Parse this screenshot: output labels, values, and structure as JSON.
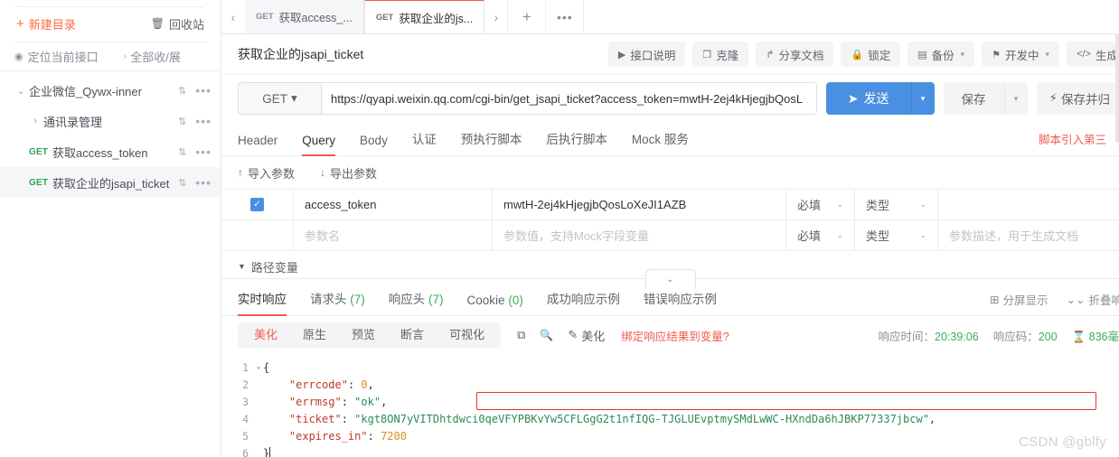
{
  "sidebar": {
    "new_dir_label": "新建目录",
    "recycle_label": "回收站",
    "locate_label": "定位当前接口",
    "expand_all_label": "全部收/展",
    "tree": [
      {
        "label": "企业微信_Qywx-inner",
        "method": "",
        "caret": "⌄",
        "indent": 1,
        "selected": false
      },
      {
        "label": "通讯录管理",
        "method": "",
        "caret": "›",
        "indent": 2,
        "selected": false
      },
      {
        "label": "获取access_token",
        "method": "GET",
        "caret": "",
        "indent": 3,
        "selected": false
      },
      {
        "label": "获取企业的jsapi_ticket",
        "method": "GET",
        "caret": "",
        "indent": 3,
        "selected": true
      }
    ]
  },
  "tabstrip": {
    "prev_icon": "‹",
    "next_icon": "›",
    "add_label": "+",
    "more_label": "•••",
    "tabs": [
      {
        "method": "GET",
        "title": "获取access_...",
        "active": false
      },
      {
        "method": "GET",
        "title": "获取企业的js...",
        "active": true
      }
    ]
  },
  "header": {
    "api_title": "获取企业的jsapi_ticket",
    "buttons": [
      {
        "icon": "▶",
        "label": "接口说明"
      },
      {
        "icon": "❐",
        "label": "克隆"
      },
      {
        "icon": "↱",
        "label": "分享文档"
      },
      {
        "icon": "🔒",
        "label": "锁定"
      },
      {
        "icon": "▤",
        "label": "备份",
        "caret": "▾"
      },
      {
        "icon": "⚑",
        "label": "开发中",
        "caret": "▾"
      },
      {
        "icon": "</>",
        "label": "生成"
      }
    ]
  },
  "request": {
    "method": "GET",
    "method_caret": "▾",
    "url": "https://qyapi.weixin.qq.com/cgi-bin/get_jsapi_ticket?access_token=mwtH-2ej4kHjegjbQosL",
    "send_label": "发送",
    "send_icon": "➤",
    "send_caret": "▾",
    "save_label": "保存",
    "save_caret": "▾",
    "save_archive_label": "保存并归",
    "save_archive_icon": "⚡",
    "tabs": [
      {
        "label": "Header",
        "active": false
      },
      {
        "label": "Query",
        "active": true
      },
      {
        "label": "Body",
        "active": false
      },
      {
        "label": "认证",
        "active": false
      },
      {
        "label": "预执行脚本",
        "active": false
      },
      {
        "label": "后执行脚本",
        "active": false
      },
      {
        "label": "Mock 服务",
        "active": false
      }
    ],
    "script_note": "脚本引入第三",
    "import_label": "导入参数",
    "import_icon": "↑",
    "export_label": "导出参数",
    "export_icon": "↓",
    "params": [
      {
        "checked": true,
        "name": "access_token",
        "value": "mwtH-2ej4kHjegjbQosLoXeJI1AZB",
        "required": "必填",
        "type": "类型",
        "desc": ""
      },
      {
        "checked": false,
        "name": "参数名",
        "value": "参数值，支持Mock字段变量",
        "required": "必填",
        "type": "类型",
        "desc": "参数描述，用于生成文档"
      }
    ],
    "path_var_label": "路径变量"
  },
  "response": {
    "collapse_handle_icon": "⌄",
    "tabs": [
      {
        "label": "实时响应",
        "count": "",
        "active": true
      },
      {
        "label": "请求头",
        "count": "(7)",
        "active": false
      },
      {
        "label": "响应头",
        "count": "(7)",
        "active": false
      },
      {
        "label": "Cookie",
        "count": "(0)",
        "active": false
      },
      {
        "label": "成功响应示例",
        "count": "",
        "active": false
      },
      {
        "label": "错误响应示例",
        "count": "",
        "active": false
      }
    ],
    "split_label": "分屏显示",
    "split_icon": "⊞",
    "collapse_label": "折叠响",
    "collapse_icon": "⌄⌄",
    "view_modes": [
      {
        "label": "美化",
        "active": true
      },
      {
        "label": "原生",
        "active": false
      },
      {
        "label": "预览",
        "active": false
      },
      {
        "label": "断言",
        "active": false
      },
      {
        "label": "可视化",
        "active": false
      }
    ],
    "copy_icon": "⧉",
    "search_icon": "🔍",
    "beautify_label": "美化",
    "beautify_icon": "✎",
    "bind_var_label": "绑定响应结果到变量?",
    "time_label": "响应时间：",
    "time_value": "20:39:06",
    "code_label": "响应码：",
    "code_value": "200",
    "duration_icon": "⌛",
    "duration_value": "836毫",
    "body_lines": [
      {
        "no": "1",
        "fold": "▾",
        "segments": [
          {
            "t": "{",
            "c": "punc"
          }
        ]
      },
      {
        "no": "2",
        "fold": "",
        "segments": [
          {
            "t": "    ",
            "c": "punc"
          },
          {
            "t": "\"errcode\"",
            "c": "k"
          },
          {
            "t": ": ",
            "c": "punc"
          },
          {
            "t": "0",
            "c": "num"
          },
          {
            "t": ",",
            "c": "punc"
          }
        ]
      },
      {
        "no": "3",
        "fold": "",
        "segments": [
          {
            "t": "    ",
            "c": "punc"
          },
          {
            "t": "\"errmsg\"",
            "c": "k"
          },
          {
            "t": ": ",
            "c": "punc"
          },
          {
            "t": "\"ok\"",
            "c": "str"
          },
          {
            "t": ",",
            "c": "punc"
          }
        ]
      },
      {
        "no": "4",
        "fold": "",
        "segments": [
          {
            "t": "    ",
            "c": "punc"
          },
          {
            "t": "\"ticket\"",
            "c": "k"
          },
          {
            "t": ": ",
            "c": "punc"
          },
          {
            "t": "\"kgt8ON7yVITDhtdwci0qeVFYPBKvYw5CFLGgG2t1nfIQG-TJGLUEvptmySMdLwWC-HXndDa6hJBKP77337jbcw\"",
            "c": "str"
          },
          {
            "t": ",",
            "c": "punc"
          }
        ]
      },
      {
        "no": "5",
        "fold": "",
        "segments": [
          {
            "t": "    ",
            "c": "punc"
          },
          {
            "t": "\"expires_in\"",
            "c": "k"
          },
          {
            "t": ": ",
            "c": "punc"
          },
          {
            "t": "7200",
            "c": "num"
          }
        ]
      },
      {
        "no": "6",
        "fold": "",
        "segments": [
          {
            "t": "}",
            "c": "punc"
          }
        ]
      }
    ],
    "highlight_line": 4
  },
  "watermark": "CSDN @gblfy",
  "colors": {
    "accent_red": "#f05b4f",
    "accent_blue": "#4a90e2",
    "method_green": "#2ea44f",
    "highlight_border": "#e8332a"
  }
}
